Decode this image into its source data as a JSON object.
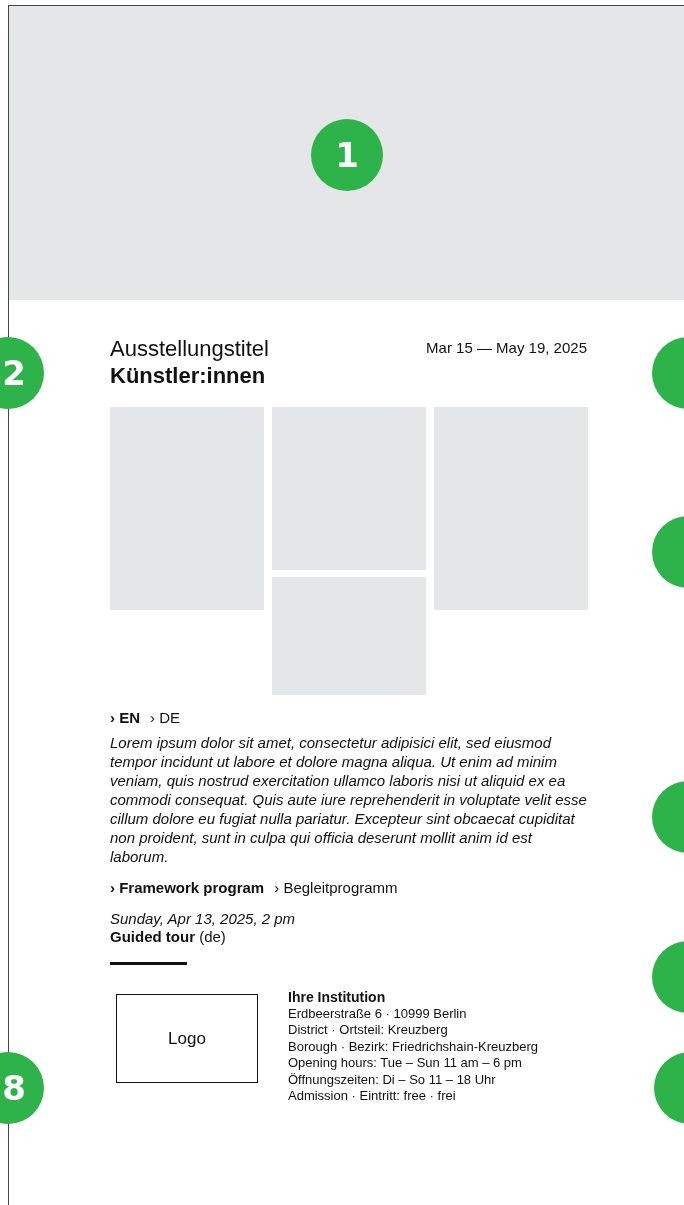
{
  "markers": [
    {
      "kind": "marker",
      "label": "1"
    },
    {
      "kind": "marker",
      "label": "2"
    },
    {
      "kind": "cut"
    },
    {
      "kind": "cut"
    },
    {
      "kind": "cut"
    },
    {
      "kind": "cut"
    },
    {
      "kind": "cut"
    },
    {
      "kind": "marker",
      "label": "8"
    }
  ],
  "exhibition": {
    "title": "Ausstellungstitel",
    "artists": "Künstler:innen",
    "dates": "Mar 15 — May 19, 2025"
  },
  "languages": [
    {
      "label": "› EN",
      "selected": true
    },
    {
      "label": "› DE",
      "selected": false
    }
  ],
  "description": "Lorem ipsum dolor sit amet, consectetur adipisici elit, sed eiusmod tempor incidunt ut labore et dolore magna aliqua. Ut enim ad minim veniam, quis nostrud exercitation ullamco laboris nisi ut aliquid ex ea commodi consequat. Quis aute iure reprehenderit in voluptate velit esse cillum dolore eu fugiat nulla pariatur. Excepteur sint obcaecat cupiditat non proident, sunt in culpa qui officia deserunt mollit anim id est laborum.",
  "program_tabs": [
    {
      "label": "› Framework program",
      "selected": true
    },
    {
      "label": "› Begleitprogramm",
      "selected": false
    }
  ],
  "event": {
    "date": "Sunday, Apr 13, 2025, 2 pm",
    "title": "**Guided tour** (de)"
  },
  "institution": {
    "logo": "Logo",
    "name": "Ihre Institution",
    "lines": [
      "Erdbeerstraße 6 · 10999 Berlin",
      "District · Ortsteil: Kreuzberg",
      "Borough · Bezirk: Friedrichshain-Kreuzberg",
      "Opening hours: Tue – Sun 11 am – 6 pm",
      "Öffnungszeiten: Di – So 11 – 18 Uhr",
      "Admission · Eintritt: free · frei"
    ]
  }
}
